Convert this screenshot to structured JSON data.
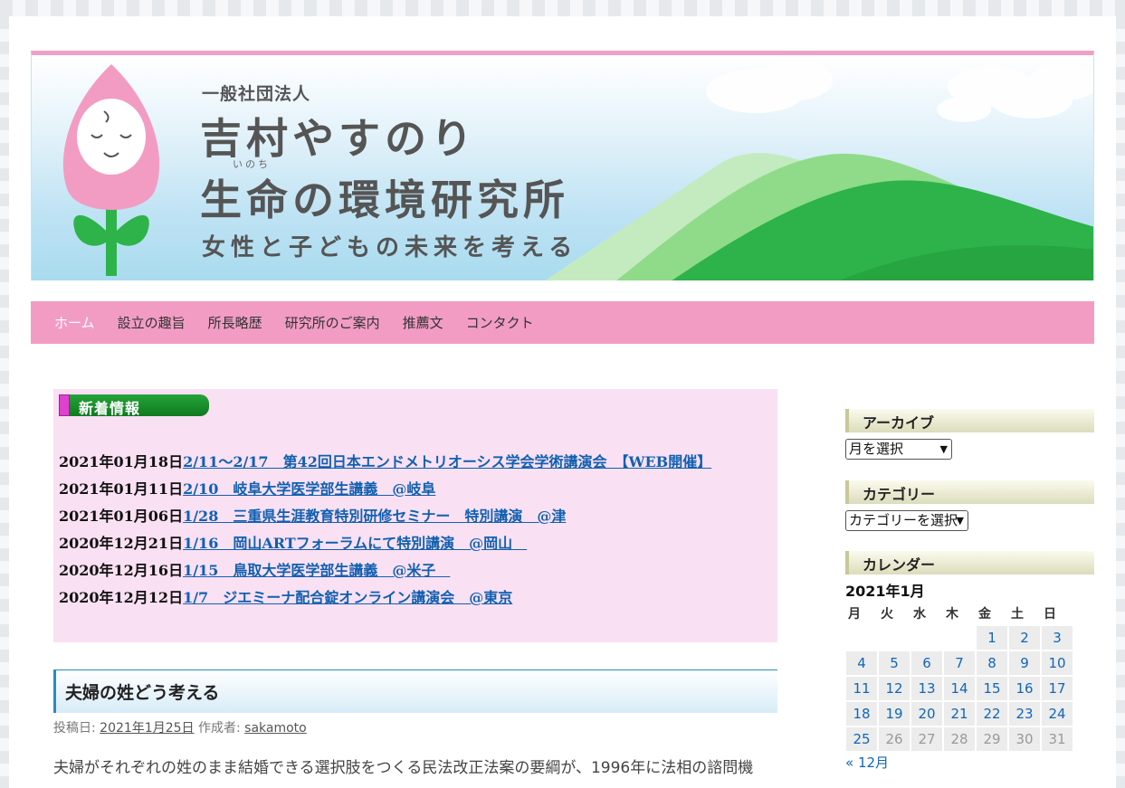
{
  "header": {
    "org_type": "一般社団法人",
    "title_line1": "吉村やすのり",
    "ruby": "いのち",
    "title_line2": "生命の環境研究所",
    "tagline": "女性と子どもの未来を考える"
  },
  "nav": {
    "items": [
      {
        "label": "ホーム",
        "active": true
      },
      {
        "label": "設立の趣旨"
      },
      {
        "label": "所長略歴"
      },
      {
        "label": "研究所のご案内"
      },
      {
        "label": "推薦文"
      },
      {
        "label": "コンタクト"
      }
    ]
  },
  "news": {
    "heading": "新着情報",
    "items": [
      {
        "date": "2021年01月18日",
        "link": "2/11～2/17　第42回日本エンドメトリオーシス学会学術講演会　【WEB開催】"
      },
      {
        "date": "2021年01月11日",
        "link": "2/10　岐阜大学医学部生講義　@岐阜"
      },
      {
        "date": "2021年01月06日",
        "link": "1/28　三重県生涯教育特別研修セミナー　特別講演　@津"
      },
      {
        "date": "2020年12月21日",
        "link": "1/16　岡山ARTフォーラムにて特別講演　@岡山　"
      },
      {
        "date": "2020年12月16日",
        "link": "1/15　鳥取大学医学部生講義　@米子　"
      },
      {
        "date": "2020年12月12日",
        "link": "1/7　ジエミーナ配合錠オンライン講演会　@東京"
      }
    ]
  },
  "post": {
    "title": "夫婦の姓どう考える",
    "meta_posted_label": "投稿日:",
    "meta_date": "2021年1月25日",
    "meta_author_label": "作成者:",
    "meta_author": "sakamoto",
    "body": "夫婦がそれぞれの姓のまま結婚できる選択肢をつくる民法改正法案の要綱が、1996年に法相の諮問機"
  },
  "sidebar": {
    "archive_title": "アーカイブ",
    "archive_select": "月を選択",
    "category_title": "カテゴリー",
    "category_select": "カテゴリーを選択",
    "calendar_title": "カレンダー",
    "calendar_caption": "2021年1月",
    "weekdays": [
      "月",
      "火",
      "水",
      "木",
      "金",
      "土",
      "日"
    ],
    "weeks": [
      [
        "",
        "",
        "",
        "",
        "1",
        "2",
        "3"
      ],
      [
        "4",
        "5",
        "6",
        "7",
        "8",
        "9",
        "10"
      ],
      [
        "11",
        "12",
        "13",
        "14",
        "15",
        "16",
        "17"
      ],
      [
        "18",
        "19",
        "20",
        "21",
        "22",
        "23",
        "24"
      ],
      [
        "25",
        "26",
        "27",
        "28",
        "29",
        "30",
        "31"
      ]
    ],
    "linked_days": [
      "1",
      "2",
      "3",
      "4",
      "5",
      "6",
      "7",
      "8",
      "9",
      "10",
      "11",
      "12",
      "13",
      "14",
      "15",
      "16",
      "17",
      "18",
      "19",
      "20",
      "21",
      "22",
      "23",
      "24",
      "25"
    ],
    "prev_link": "« 12月"
  },
  "colors": {
    "nav_bg": "#f29cc4",
    "news_bg": "#fae0f3",
    "link": "#1060b0",
    "mountain_green": "#2db34a"
  }
}
